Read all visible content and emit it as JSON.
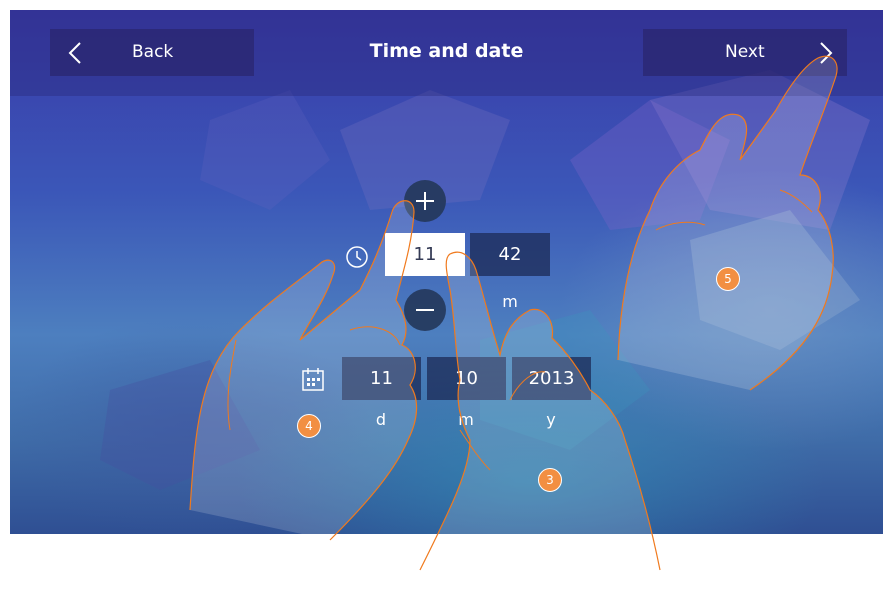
{
  "header": {
    "back_label": "Back",
    "title": "Time and date",
    "next_label": "Next"
  },
  "time": {
    "hour": "11",
    "minute": "42",
    "minute_unit": "m"
  },
  "date": {
    "day": "11",
    "month": "10",
    "year": "2013",
    "day_unit": "d",
    "month_unit": "m",
    "year_unit": "y"
  },
  "callouts": [
    "3",
    "4",
    "5"
  ],
  "colors": {
    "accent_orange": "#f07a1e",
    "button_dark": "#2a266e",
    "selected_field": "#ffffff"
  },
  "icons": [
    "chevron-left-icon",
    "chevron-right-icon",
    "plus-icon",
    "minus-icon",
    "clock-icon",
    "calendar-icon"
  ]
}
